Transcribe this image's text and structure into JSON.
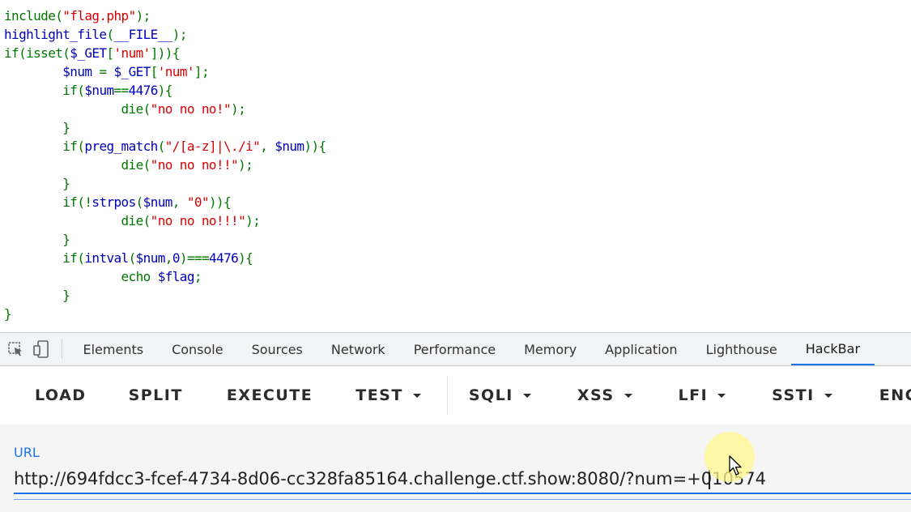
{
  "code": {
    "lines": [
      {
        "tokens": [
          {
            "t": "include(",
            "c": "kw"
          },
          {
            "t": "\"flag.php\"",
            "c": "str"
          },
          {
            "t": ");",
            "c": "kw"
          }
        ]
      },
      {
        "tokens": [
          {
            "t": "highlight_file",
            "c": "def"
          },
          {
            "t": "(",
            "c": "kw"
          },
          {
            "t": "__FILE__",
            "c": "def"
          },
          {
            "t": ");",
            "c": "kw"
          }
        ]
      },
      {
        "tokens": [
          {
            "t": "if(isset(",
            "c": "kw"
          },
          {
            "t": "$_GET",
            "c": "def"
          },
          {
            "t": "[",
            "c": "kw"
          },
          {
            "t": "'num'",
            "c": "str"
          },
          {
            "t": "])){",
            "c": "kw"
          }
        ]
      },
      {
        "tokens": [
          {
            "t": "        ",
            "c": "kw"
          },
          {
            "t": "$num ",
            "c": "def"
          },
          {
            "t": "= ",
            "c": "kw"
          },
          {
            "t": "$_GET",
            "c": "def"
          },
          {
            "t": "[",
            "c": "kw"
          },
          {
            "t": "'num'",
            "c": "str"
          },
          {
            "t": "];",
            "c": "kw"
          }
        ]
      },
      {
        "tokens": [
          {
            "t": "        if(",
            "c": "kw"
          },
          {
            "t": "$num",
            "c": "def"
          },
          {
            "t": "==",
            "c": "kw"
          },
          {
            "t": "4476",
            "c": "def"
          },
          {
            "t": "){",
            "c": "kw"
          }
        ]
      },
      {
        "tokens": [
          {
            "t": "                die(",
            "c": "kw"
          },
          {
            "t": "\"no no no!\"",
            "c": "str"
          },
          {
            "t": ");",
            "c": "kw"
          }
        ]
      },
      {
        "tokens": [
          {
            "t": "        }",
            "c": "kw"
          }
        ]
      },
      {
        "tokens": [
          {
            "t": "        if(",
            "c": "kw"
          },
          {
            "t": "preg_match",
            "c": "def"
          },
          {
            "t": "(",
            "c": "kw"
          },
          {
            "t": "\"/[a-z]|\\./i\"",
            "c": "str"
          },
          {
            "t": ", ",
            "c": "kw"
          },
          {
            "t": "$num",
            "c": "def"
          },
          {
            "t": ")){",
            "c": "kw"
          }
        ]
      },
      {
        "tokens": [
          {
            "t": "                die(",
            "c": "kw"
          },
          {
            "t": "\"no no no!!\"",
            "c": "str"
          },
          {
            "t": ");",
            "c": "kw"
          }
        ]
      },
      {
        "tokens": [
          {
            "t": "        }",
            "c": "kw"
          }
        ]
      },
      {
        "tokens": [
          {
            "t": "        if(!",
            "c": "kw"
          },
          {
            "t": "strpos",
            "c": "def"
          },
          {
            "t": "(",
            "c": "kw"
          },
          {
            "t": "$num",
            "c": "def"
          },
          {
            "t": ", ",
            "c": "kw"
          },
          {
            "t": "\"0\"",
            "c": "str"
          },
          {
            "t": ")){",
            "c": "kw"
          }
        ]
      },
      {
        "tokens": [
          {
            "t": "                die(",
            "c": "kw"
          },
          {
            "t": "\"no no no!!!\"",
            "c": "str"
          },
          {
            "t": ");",
            "c": "kw"
          }
        ]
      },
      {
        "tokens": [
          {
            "t": "        }",
            "c": "kw"
          }
        ]
      },
      {
        "tokens": [
          {
            "t": "        if(",
            "c": "kw"
          },
          {
            "t": "intval",
            "c": "def"
          },
          {
            "t": "(",
            "c": "kw"
          },
          {
            "t": "$num",
            "c": "def"
          },
          {
            "t": ",",
            "c": "kw"
          },
          {
            "t": "0",
            "c": "def"
          },
          {
            "t": ")===",
            "c": "kw"
          },
          {
            "t": "4476",
            "c": "def"
          },
          {
            "t": "){",
            "c": "kw"
          }
        ]
      },
      {
        "tokens": [
          {
            "t": "                echo ",
            "c": "kw"
          },
          {
            "t": "$flag",
            "c": "def"
          },
          {
            "t": ";",
            "c": "kw"
          }
        ]
      },
      {
        "tokens": [
          {
            "t": "        }",
            "c": "kw"
          }
        ]
      },
      {
        "tokens": [
          {
            "t": "}",
            "c": "kw"
          }
        ]
      }
    ]
  },
  "devtools": {
    "tabs": [
      {
        "label": "Elements",
        "active": false
      },
      {
        "label": "Console",
        "active": false
      },
      {
        "label": "Sources",
        "active": false
      },
      {
        "label": "Network",
        "active": false
      },
      {
        "label": "Performance",
        "active": false
      },
      {
        "label": "Memory",
        "active": false
      },
      {
        "label": "Application",
        "active": false
      },
      {
        "label": "Lighthouse",
        "active": false
      },
      {
        "label": "HackBar",
        "active": true
      }
    ],
    "icons": [
      "inspect-element-icon",
      "device-toolbar-icon"
    ]
  },
  "hackbar": {
    "buttons": [
      {
        "label": "LOAD",
        "dropdown": false
      },
      {
        "label": "SPLIT",
        "dropdown": false
      },
      {
        "label": "EXECUTE",
        "dropdown": false
      },
      {
        "label": "TEST",
        "dropdown": true
      },
      {
        "label": "SQLI",
        "dropdown": true
      },
      {
        "label": "XSS",
        "dropdown": true
      },
      {
        "label": "LFI",
        "dropdown": true
      },
      {
        "label": "SSTI",
        "dropdown": true
      },
      {
        "label": "ENCO",
        "dropdown": false
      }
    ],
    "url_label": "URL",
    "url_value": "http://694fdcc3-fcef-4734-8d06-cc328fa85164.challenge.ctf.show:8080/?num=+010574"
  },
  "colors": {
    "code_keyword": "#007700",
    "code_default": "#0000bb",
    "code_string": "#dd0000",
    "accent": "#1a73e8"
  }
}
